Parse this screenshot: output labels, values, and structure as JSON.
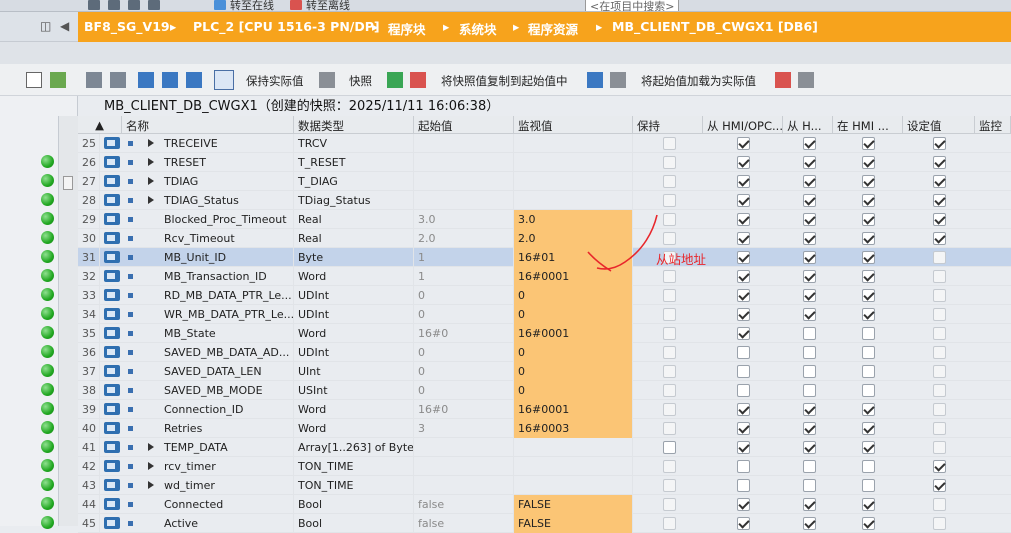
{
  "top_toolbar": {
    "go_online": "转至在线",
    "go_offline": "转至离线",
    "search_placeholder": "<在项目中搜索>"
  },
  "breadcrumb": [
    "BF8_SG_V19",
    "PLC_2 [CPU 1516-3 PN/DP]",
    "程序块",
    "系统块",
    "程序资源",
    "MB_CLIENT_DB_CWGX1 [DB6]"
  ],
  "editor_toolbar": {
    "keep_actual": "保持实际值",
    "snapshot": "快照",
    "copy_snapshot": "将快照值复制到起始值中",
    "load_start": "将起始值加载为实际值"
  },
  "snapshot_title": "MB_CLIENT_DB_CWGX1（创建的快照：2025/11/11 16:06:38）",
  "columns": [
    "名称",
    "数据类型",
    "起始值",
    "监视值",
    "保持",
    "从 HMI/OPC...",
    "从 H...",
    "在 HMI ...",
    "设定值",
    "监控"
  ],
  "rows": [
    {
      "n": "25",
      "name": "TRECEIVE",
      "type": "TRCV",
      "start": "",
      "monitor": "",
      "expand": true,
      "dot": false,
      "cbs": [
        "",
        "on",
        "on",
        "on",
        "on"
      ]
    },
    {
      "n": "26",
      "name": "TRESET",
      "type": "T_RESET",
      "start": "",
      "monitor": "",
      "expand": true,
      "dot": true,
      "cbs": [
        "",
        "on",
        "on",
        "on",
        "on"
      ]
    },
    {
      "n": "27",
      "name": "TDIAG",
      "type": "T_DIAG",
      "start": "",
      "monitor": "",
      "expand": true,
      "dot": true,
      "cbs": [
        "",
        "on",
        "on",
        "on",
        "on"
      ]
    },
    {
      "n": "28",
      "name": "TDIAG_Status",
      "type": "TDiag_Status",
      "start": "",
      "monitor": "",
      "expand": true,
      "dot": true,
      "cbs": [
        "",
        "on",
        "on",
        "on",
        "on"
      ]
    },
    {
      "n": "29",
      "name": "Blocked_Proc_Timeout",
      "type": "Real",
      "start": "3.0",
      "monitor": "3.0",
      "expand": false,
      "dot": true,
      "cbs": [
        "",
        "on",
        "on",
        "on",
        "on"
      ]
    },
    {
      "n": "30",
      "name": "Rcv_Timeout",
      "type": "Real",
      "start": "2.0",
      "monitor": "2.0",
      "expand": false,
      "dot": true,
      "cbs": [
        "",
        "on",
        "on",
        "on",
        "on"
      ]
    },
    {
      "n": "31",
      "name": "MB_Unit_ID",
      "type": "Byte",
      "start": "1",
      "monitor": "16#01",
      "expand": false,
      "dot": true,
      "sel": true,
      "cbs": [
        "",
        "on",
        "on",
        "on",
        "d"
      ]
    },
    {
      "n": "32",
      "name": "MB_Transaction_ID",
      "type": "Word",
      "start": "1",
      "monitor": "16#0001",
      "expand": false,
      "dot": true,
      "cbs": [
        "",
        "on",
        "on",
        "on",
        "d"
      ]
    },
    {
      "n": "33",
      "name": "RD_MB_DATA_PTR_Le...",
      "type": "UDInt",
      "start": "0",
      "monitor": "0",
      "expand": false,
      "dot": true,
      "cbs": [
        "",
        "on",
        "on",
        "on",
        "d"
      ]
    },
    {
      "n": "34",
      "name": "WR_MB_DATA_PTR_Le...",
      "type": "UDInt",
      "start": "0",
      "monitor": "0",
      "expand": false,
      "dot": true,
      "cbs": [
        "",
        "on",
        "on",
        "on",
        "d"
      ]
    },
    {
      "n": "35",
      "name": "MB_State",
      "type": "Word",
      "start": "16#0",
      "monitor": "16#0001",
      "expand": false,
      "dot": true,
      "cbs": [
        "",
        "on",
        "",
        "",
        "d"
      ]
    },
    {
      "n": "36",
      "name": "SAVED_MB_DATA_AD...",
      "type": "UDInt",
      "start": "0",
      "monitor": "0",
      "expand": false,
      "dot": true,
      "cbs": [
        "",
        "",
        "",
        "",
        "d"
      ]
    },
    {
      "n": "37",
      "name": "SAVED_DATA_LEN",
      "type": "UInt",
      "start": "0",
      "monitor": "0",
      "expand": false,
      "dot": true,
      "cbs": [
        "",
        "",
        "",
        "",
        "d"
      ]
    },
    {
      "n": "38",
      "name": "SAVED_MB_MODE",
      "type": "USInt",
      "start": "0",
      "monitor": "0",
      "expand": false,
      "dot": true,
      "cbs": [
        "",
        "",
        "",
        "",
        "d"
      ]
    },
    {
      "n": "39",
      "name": "Connection_ID",
      "type": "Word",
      "start": "16#0",
      "monitor": "16#0001",
      "expand": false,
      "dot": true,
      "cbs": [
        "",
        "on",
        "on",
        "on",
        "d"
      ]
    },
    {
      "n": "40",
      "name": "Retries",
      "type": "Word",
      "start": "3",
      "monitor": "16#0003",
      "expand": false,
      "dot": true,
      "cbs": [
        "",
        "on",
        "on",
        "on",
        "d"
      ]
    },
    {
      "n": "41",
      "name": "TEMP_DATA",
      "type": "Array[1..263] of Byte",
      "start": "",
      "monitor": "",
      "expand": true,
      "dot": true,
      "cbs": [
        "x",
        "on",
        "on",
        "on",
        "d"
      ]
    },
    {
      "n": "42",
      "name": "rcv_timer",
      "type": "TON_TIME",
      "start": "",
      "monitor": "",
      "expand": true,
      "dot": true,
      "cbs": [
        "",
        "",
        "",
        "",
        "on"
      ]
    },
    {
      "n": "43",
      "name": "wd_timer",
      "type": "TON_TIME",
      "start": "",
      "monitor": "",
      "expand": true,
      "dot": true,
      "cbs": [
        "",
        "",
        "",
        "",
        "on"
      ]
    },
    {
      "n": "44",
      "name": "Connected",
      "type": "Bool",
      "start": "false",
      "monitor": "FALSE",
      "expand": false,
      "dot": true,
      "cbs": [
        "",
        "on",
        "on",
        "on",
        "d"
      ]
    },
    {
      "n": "45",
      "name": "Active",
      "type": "Bool",
      "start": "false",
      "monitor": "FALSE",
      "expand": false,
      "dot": true,
      "cbs": [
        "",
        "on",
        "on",
        "on",
        "d"
      ]
    }
  ],
  "annotation": "从站地址",
  "colors": {
    "accent": "#f7a31c",
    "monitor_bg": "#fbc575",
    "selection": "#c3d3ea"
  }
}
